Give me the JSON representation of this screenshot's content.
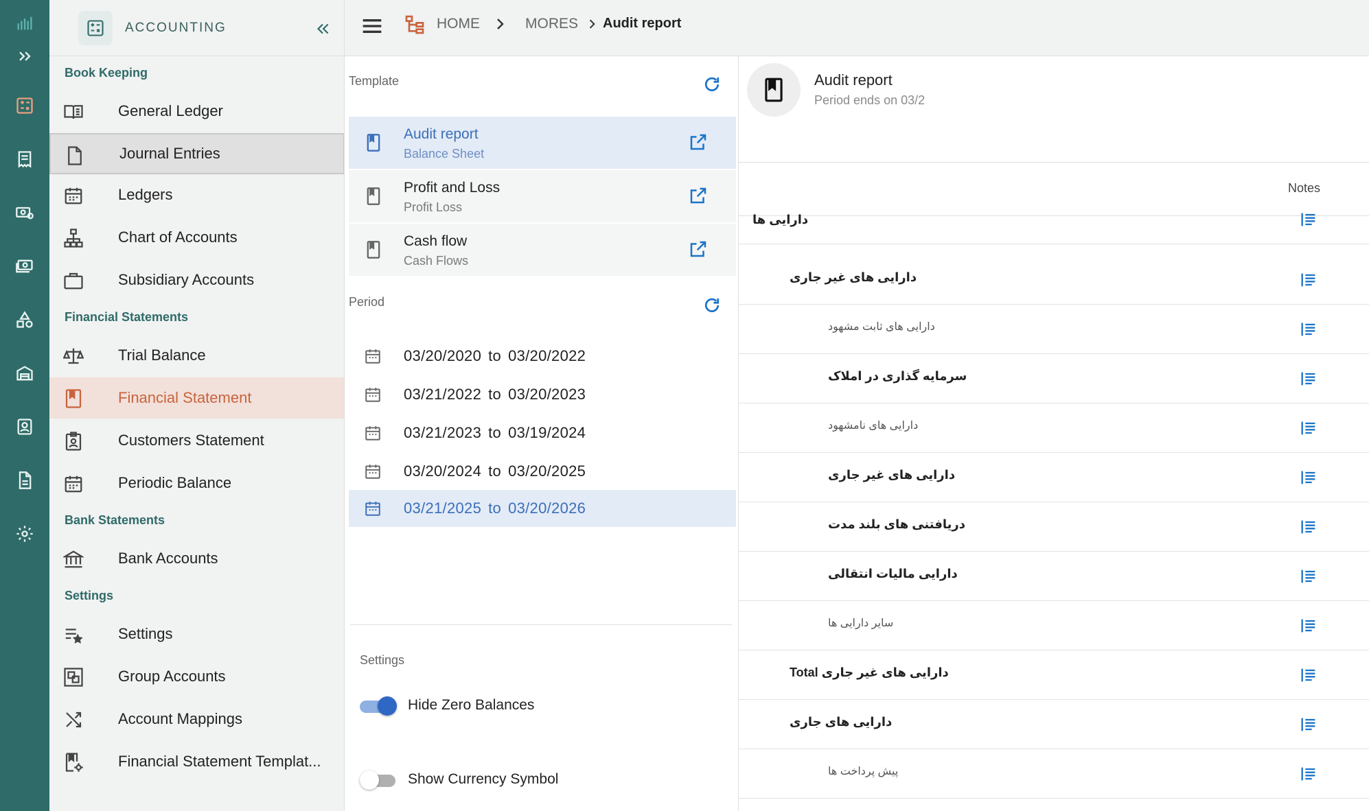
{
  "app": {
    "title": "ACCOUNTING"
  },
  "rail": {
    "items": [
      "logo-icon",
      "expand-icon",
      "accounting-icon",
      "receipt-icon",
      "payments-icon",
      "cash-icon",
      "shapes-icon",
      "warehouse-icon",
      "contact-icon",
      "document-icon",
      "gear-icon"
    ]
  },
  "sidebar": {
    "sections": {
      "bookkeeping": "Book Keeping",
      "financial_statements": "Financial Statements",
      "bank_statements": "Bank Statements",
      "settings": "Settings"
    },
    "items": {
      "general_ledger": "General Ledger",
      "journal_entries": "Journal Entries",
      "ledgers": "Ledgers",
      "chart_of_accounts": "Chart of Accounts",
      "subsidiary_accounts": "Subsidiary Accounts",
      "trial_balance": "Trial Balance",
      "financial_statement": "Financial Statement",
      "customers_statement": "Customers Statement",
      "periodic_balance": "Periodic Balance",
      "bank_accounts": "Bank Accounts",
      "settings": "Settings",
      "group_accounts": "Group Accounts",
      "account_mappings": "Account Mappings",
      "fs_templates": "Financial Statement Templat..."
    },
    "active_accent": "#c8643d"
  },
  "breadcrumb": {
    "home": "HOME",
    "mores": "MORES",
    "current": "Audit report"
  },
  "template_panel": {
    "label": "Template",
    "items": [
      {
        "title": "Audit report",
        "subtitle": "Balance Sheet",
        "selected": true
      },
      {
        "title": "Profit and Loss",
        "subtitle": "Profit Loss",
        "selected": false
      },
      {
        "title": "Cash flow",
        "subtitle": "Cash Flows",
        "selected": false
      }
    ]
  },
  "period_panel": {
    "label": "Period",
    "to_word": "to",
    "items": [
      {
        "from": "03/20/2020",
        "to": "03/20/2022",
        "selected": false
      },
      {
        "from": "03/21/2022",
        "to": "03/20/2023",
        "selected": false
      },
      {
        "from": "03/21/2023",
        "to": "03/19/2024",
        "selected": false
      },
      {
        "from": "03/20/2024",
        "to": "03/20/2025",
        "selected": false
      },
      {
        "from": "03/21/2025",
        "to": "03/20/2026",
        "selected": true
      }
    ]
  },
  "settings_panel": {
    "label": "Settings",
    "hide_zero": {
      "label": "Hide Zero Balances",
      "on": true
    },
    "currency_symbol": {
      "label": "Show Currency Symbol",
      "on": false
    }
  },
  "report": {
    "title": "Audit report",
    "subtitle": "Period ends on 03/2",
    "notes_header": "Notes",
    "rows": [
      {
        "label": "دارایی ها",
        "level": 0,
        "style": "bold"
      },
      {
        "label": "دارایی های غیر جاری",
        "level": 1,
        "style": "bold"
      },
      {
        "label": "دارایی های ثابت مشهود",
        "level": 2,
        "style": "light"
      },
      {
        "label": "سرمایه گذاری در املاک",
        "level": 2,
        "style": "bold"
      },
      {
        "label": "دارایی های نامشهود",
        "level": 2,
        "style": "light"
      },
      {
        "label": "دارایی های غیر جاری",
        "level": 2,
        "style": "bold"
      },
      {
        "label": "دریافتنی های بلند مدت",
        "level": 2,
        "style": "bold"
      },
      {
        "label": "دارایی مالیات انتقالی",
        "level": 2,
        "style": "bold"
      },
      {
        "label": "سایر دارایی ها",
        "level": 2,
        "style": "light"
      },
      {
        "label": "Total دارایی های غیر جاری",
        "level": 1,
        "style": "bold"
      },
      {
        "label": "دارایی های جاری",
        "level": 1,
        "style": "bold"
      },
      {
        "label": "پیش پرداخت ها",
        "level": 2,
        "style": "light"
      }
    ]
  },
  "colors": {
    "rail": "#2f6b68",
    "link_blue": "#1a73c8",
    "selected_bg": "#e3ebf7",
    "active_bg": "#f2e0da"
  }
}
